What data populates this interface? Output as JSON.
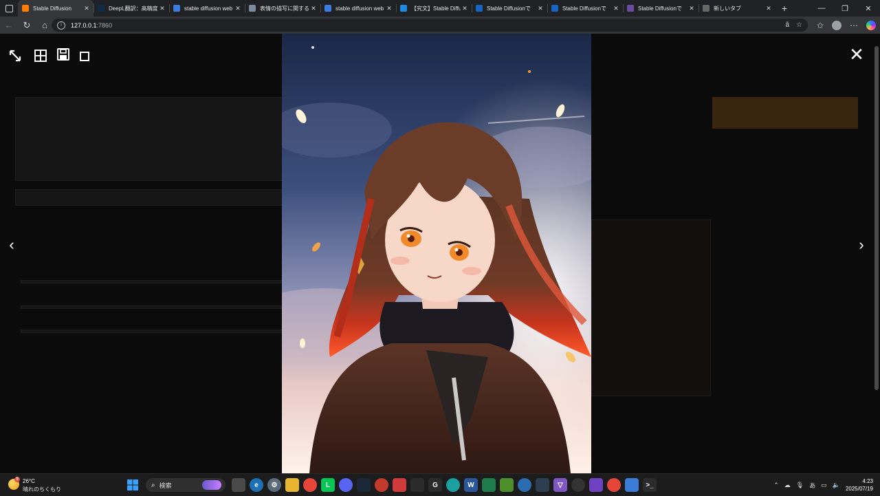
{
  "browser": {
    "tabs": [
      {
        "title": "Stable Diffusion",
        "favicon": "gradio-icon",
        "color": "#ff7c00",
        "active": true
      },
      {
        "title": "DeepL翻訳：高精度",
        "favicon": "deepl-icon",
        "color": "#0f2b46",
        "active": false
      },
      {
        "title": "stable diffusion web",
        "favicon": "search-icon",
        "color": "#3c7be0",
        "active": false
      },
      {
        "title": "表情の描写に関する",
        "favicon": "page-icon",
        "color": "#7a8aa0",
        "active": false
      },
      {
        "title": "stable diffusion web",
        "favicon": "search-icon",
        "color": "#3c7be0",
        "active": false
      },
      {
        "title": "【究文】Stable Diffu",
        "favicon": "page-icon",
        "color": "#1e88e5",
        "active": false
      },
      {
        "title": "Stable Diffusionで",
        "favicon": "page-icon",
        "color": "#1565c0",
        "active": false
      },
      {
        "title": "Stable Diffusionで",
        "favicon": "page-icon",
        "color": "#1565c0",
        "active": false
      },
      {
        "title": "Stable Diffusionで",
        "favicon": "page-icon",
        "color": "#6a4c9c",
        "active": false
      },
      {
        "title": "新しいタブ",
        "favicon": "newtab-icon",
        "color": "#666666",
        "active": false
      }
    ],
    "url_host": "127.0.0.1",
    "url_port": ":7860",
    "read_aloud_label": "ã"
  },
  "lightbox": {
    "tools": [
      "fullscreen-icon",
      "tile-icon",
      "save-icon",
      "toggle-icon"
    ],
    "close_glyph": "✕",
    "prev_glyph": "‹",
    "next_glyph": "›"
  },
  "taskbar": {
    "weather_temp": "26°C",
    "weather_desc": "晴れのちくもり",
    "weather_badge": "9",
    "search_placeholder": "検索",
    "time": "4:23",
    "date": "2025/07/19",
    "ime": "あ"
  }
}
